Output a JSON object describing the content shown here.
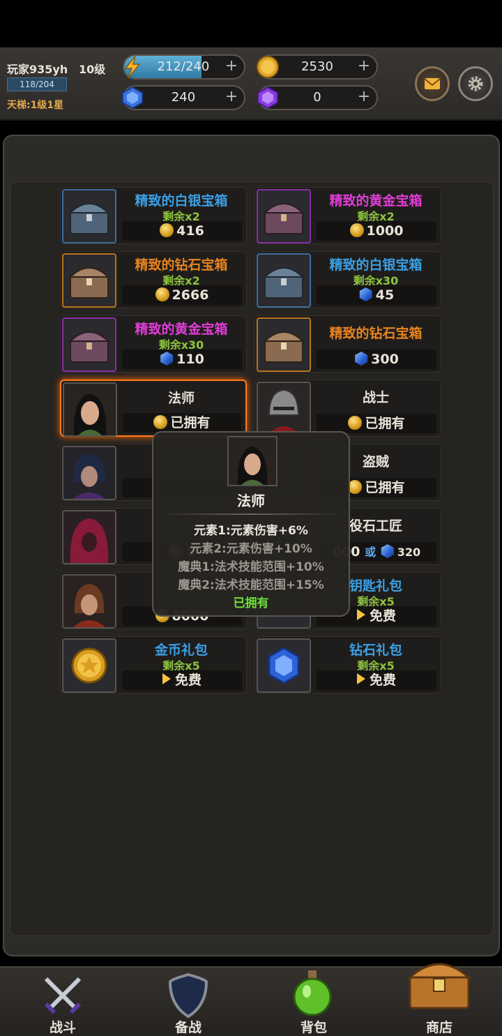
{
  "player": {
    "name": "玩家935yh",
    "level": "10级",
    "xp": "118/204",
    "ladder": "天梯:1级1星"
  },
  "resources": {
    "energy": {
      "value": "212/240",
      "fill": 0.883
    },
    "gold": {
      "value": "2530"
    },
    "gem": {
      "value": "240"
    },
    "crystal": {
      "value": "0"
    },
    "plus": "+"
  },
  "shop": {
    "items": [
      {
        "title": "精致的白银宝箱",
        "sub": "剩余x2",
        "price": "416",
        "currency": "coin"
      },
      {
        "title": "精致的黄金宝箱",
        "sub": "剩余x2",
        "price": "1000",
        "currency": "coin"
      },
      {
        "title": "精致的钻石宝箱",
        "sub": "剩余x2",
        "price": "2666",
        "currency": "coin"
      },
      {
        "title": "精致的白银宝箱",
        "sub": "剩余x30",
        "price": "45",
        "currency": "gem"
      },
      {
        "title": "精致的黄金宝箱",
        "sub": "剩余x30",
        "price": "110",
        "currency": "gem"
      },
      {
        "title": "精致的钻石宝箱",
        "price": "300",
        "currency": "gem"
      },
      {
        "title": "法师",
        "status": "已拥有"
      },
      {
        "title": "战士",
        "status": "已拥有"
      },
      {
        "title": "盗贼",
        "status": "已拥有"
      },
      {
        "title": "役石工匠",
        "price_coin": "000",
        "or": "或",
        "price_gem": "320"
      },
      {
        "title": "钥匙礼包",
        "sub": "剩余x5",
        "action": "免费"
      },
      {
        "title": "金币礼包",
        "sub": "剩余x5",
        "action": "免费"
      },
      {
        "title": "钻石礼包",
        "sub": "剩余x5",
        "action": "免费"
      }
    ],
    "partial": {
      "price1": "5",
      "price2": "8000"
    }
  },
  "tooltip": {
    "name": "法师",
    "lines": [
      "元素1:元素伤害+6%",
      "元素2:元素伤害+10%",
      "魔典1:法术技能范围+10%",
      "魔典2:法术技能范围+15%"
    ],
    "status": "已拥有"
  },
  "nav": {
    "battle": "战斗",
    "prepare": "备战",
    "bag": "背包",
    "shop": "商店"
  },
  "colors": {
    "accent_orange": "#ff7a1a",
    "owned_green": "#6ee03a",
    "title_blue": "#3aa0e6",
    "title_pink": "#e03dd6",
    "title_orange": "#e8831f"
  }
}
